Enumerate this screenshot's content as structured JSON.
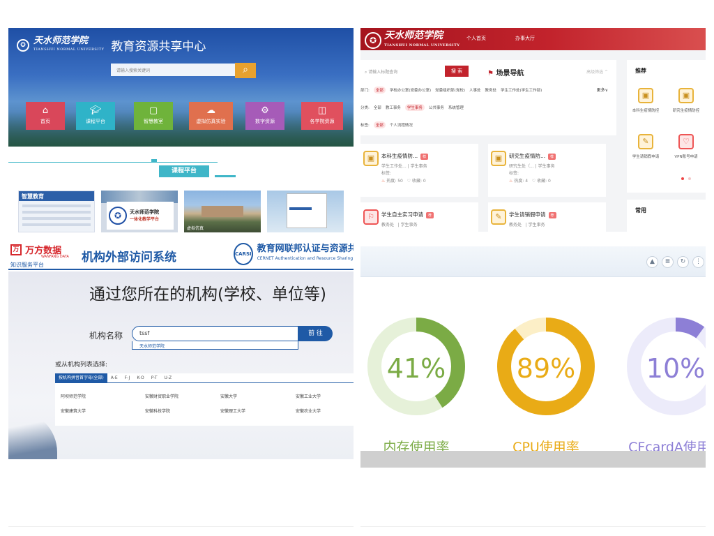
{
  "p1": {
    "school_name": "天水师范学院",
    "school_en": "TIANSHUI NORMAL UNIVERSITY",
    "title": "教育资源共享中心",
    "search_placeholder": "请输入搜索关键词",
    "nav": [
      "首页",
      "课程平台",
      "智慧教室",
      "虚拟仿真实验",
      "数字资源",
      "各学院资源"
    ],
    "nav_colors": [
      "#d9475a",
      "#2fb3c8",
      "#6fb33b",
      "#e0704e",
      "#a65bb8",
      "#e0505e"
    ],
    "section_tab": "课程平台",
    "thumb1_title": "智慧教育",
    "thumb2_title": "天水师范学院",
    "thumb2_sub": "一体化教学平台",
    "thumb3_caption": "虚拟仿真"
  },
  "p2": {
    "school_name": "天水师范学院",
    "school_en": "TIANSHUI NORMAL UNIVERSITY",
    "nav": [
      "个人首页",
      "办事大厅"
    ],
    "search_placeholder": "请输入标题查询",
    "search_btn": "搜 索",
    "scene_nav": "场景导航",
    "adv": "高级筛选 ^",
    "dept_label": "部门:",
    "dept_items": [
      "全部",
      "学校办公室(党委办公室)",
      "党委组织部(党校)",
      "人事处",
      "教务处",
      "学生工作处(学生工作部)"
    ],
    "more": "更多∨",
    "cat_label": "分类:",
    "cat_items": [
      "全部",
      "教工事务",
      "学生事务",
      "公共事务",
      "系统管理"
    ],
    "tag_label": "标签:",
    "tag_items": [
      "全部",
      "个人流程情况"
    ],
    "cards": [
      {
        "name": "本科生疫情防...",
        "badge": "荐",
        "dept": "学生工作处...",
        "cat": "| 学生事务",
        "tag": "标签:",
        "hot": "热度: 50",
        "fav": "收藏: 0"
      },
      {
        "name": "研究生疫情防...",
        "badge": "荐",
        "dept": "研究生处（...",
        "cat": "| 学生事务",
        "tag": "标签:",
        "hot": "热度: 4",
        "fav": "收藏: 0"
      },
      {
        "name": "学生自主实习申请",
        "badge": "荐",
        "dept": "教务处",
        "cat": "| 学生事务"
      },
      {
        "name": "学生请销假申请",
        "badge": "荐",
        "dept": "教务处",
        "cat": "| 学生事务"
      }
    ],
    "side_title": "推荐",
    "side_items": [
      "本科生疫情防控",
      "研究生疫情防控",
      "学生请销假申请",
      "VPN账号申请"
    ],
    "side2_title": "常用"
  },
  "p3": {
    "brand": "万方数据",
    "brand_en": "WANFANG DATA",
    "brand_sub": "知识服务平台",
    "title": "机构外部访问系统",
    "carsi_badge": "CARSI",
    "carsi_title": "教育网联邦认证与资源共享",
    "carsi_en": "CERNET Authentication and Resource Sharing",
    "headline": "通过您所在的机构(学校、单位等)",
    "inst_label": "机构名称",
    "input_value": "tssf",
    "go_btn": "前 往",
    "suggest": "天水师范学院",
    "or_label": "或从机构列表选择:",
    "tabs": [
      "按机构拼音首字母(全部)",
      "A-E",
      "F-J",
      "K-O",
      "P-T",
      "U-Z"
    ],
    "list": [
      "阿坝师范学院",
      "安徽财贸职业学院",
      "安徽大学",
      "安徽工业大学",
      "安徽建筑大学",
      "安徽科技学院",
      "安徽理工大学",
      "安徽农业大学"
    ]
  },
  "p4": {
    "toolbar_icons": [
      "eject-icon",
      "list-icon",
      "refresh-icon",
      "menu-icon"
    ],
    "gauges": [
      {
        "pct": "41%",
        "value": 0.41,
        "label": "内存使用率",
        "color": "#7bab45",
        "track": "#e6f1d9"
      },
      {
        "pct": "89%",
        "value": 0.89,
        "label": "CPU使用率",
        "color": "#e9ab16",
        "track": "#fcefc7"
      },
      {
        "pct": "10%",
        "value": 0.1,
        "label": "CFcardA使用率",
        "color": "#8d7fd6",
        "track": "#ecebfa"
      }
    ]
  }
}
